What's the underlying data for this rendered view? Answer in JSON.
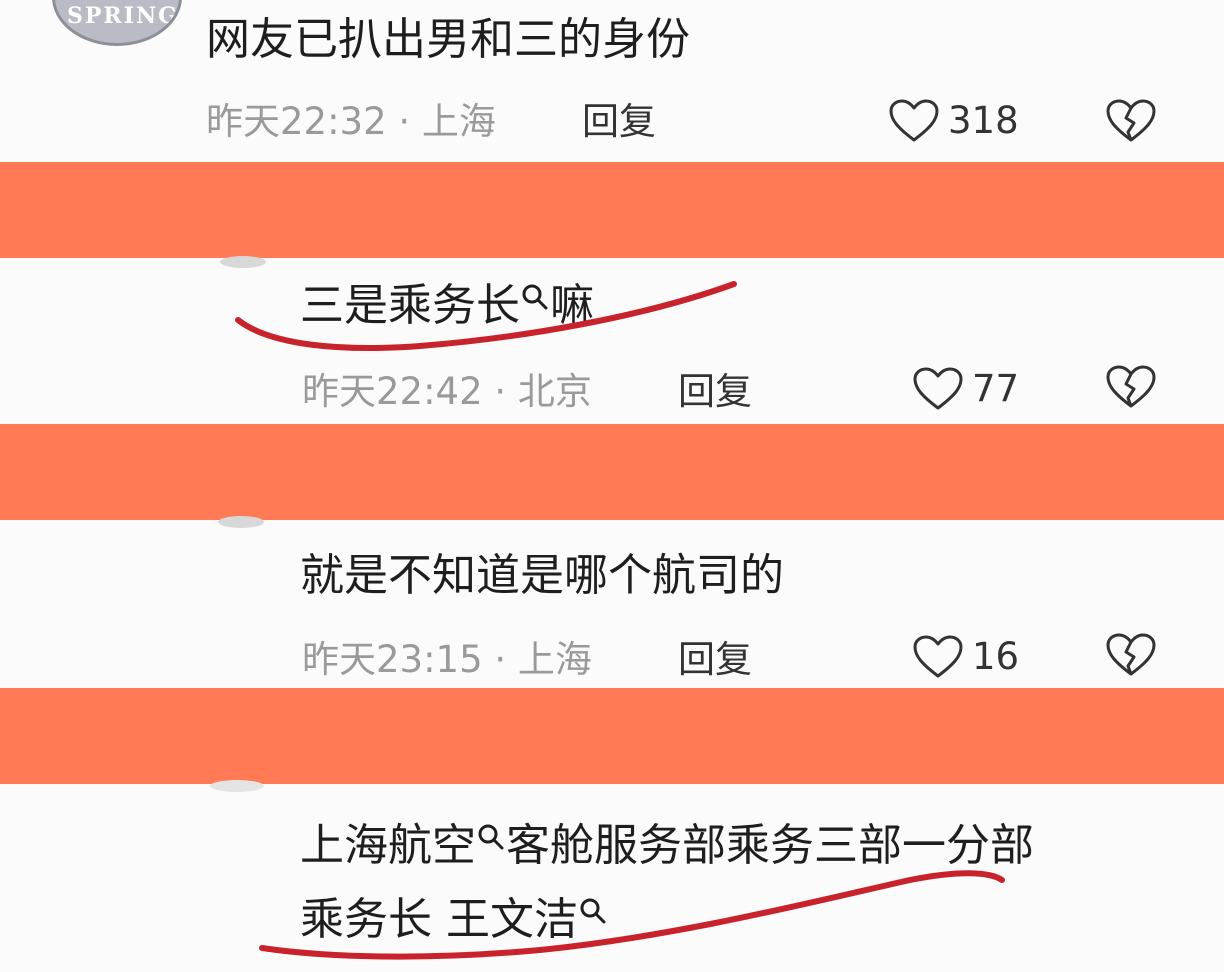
{
  "comments": [
    {
      "avatar_text": "SPRING",
      "text": "网友已扒出男和三的身份",
      "time_location": "昨天22:32 · 上海",
      "reply_label": "回复",
      "likes": "318"
    },
    {
      "text": "三是乘务长",
      "text_suffix": "嘛",
      "time_location": "昨天22:42 · 北京",
      "reply_label": "回复",
      "likes": "77"
    },
    {
      "text": "就是不知道是哪个航司的",
      "time_location": "昨天23:15 · 上海",
      "reply_label": "回复",
      "likes": "16"
    },
    {
      "text_line1_a": "上海航空",
      "text_line1_b": "客舱服务部乘务三部一分部",
      "text_line2": "乘务长 王文洁"
    }
  ],
  "icons": {
    "like": "heart-outline-icon",
    "dislike": "broken-heart-icon",
    "search": "search-icon"
  },
  "colors": {
    "band": "#ff7a55",
    "underline": "#c8232c",
    "meta_text": "#9a9a9a",
    "body_text": "#1e1e1e"
  }
}
